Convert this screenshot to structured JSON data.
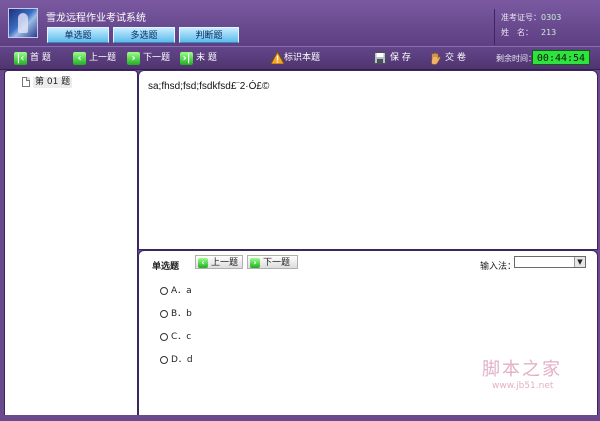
{
  "app": {
    "title": "雪龙远程作业考试系统",
    "tabs": [
      "单选题",
      "多选题",
      "判断题"
    ]
  },
  "info": {
    "id_label": "准考证号：",
    "id_value": "0303",
    "name_label": "姓　名：",
    "name_value": "213"
  },
  "toolbar": {
    "first": "首 题",
    "prev": "上一题",
    "next": "下一题",
    "last": "末 题",
    "mark": "标识本题",
    "save": "保 存",
    "submit": "交 卷",
    "remaining_label": "剩余时间：",
    "remaining_time": "00:44:54"
  },
  "tree": {
    "item": "第 01 题"
  },
  "question": {
    "text": "sa;fhsd;fsd;fsdkfsd£¨2·Ó£©"
  },
  "answer": {
    "type_label": "单选题",
    "prev": "上一题",
    "next": "下一题",
    "ime_label": "输入法：",
    "options": [
      "A．a",
      "B．b",
      "C．c",
      "D．d"
    ]
  },
  "watermark": {
    "main": "脚本之家",
    "url": "www.jb51.net"
  },
  "colors": {
    "frame": "#6a4a8c",
    "timer_bg": "#2fe33f",
    "tab_blue": "#5bbcea"
  }
}
